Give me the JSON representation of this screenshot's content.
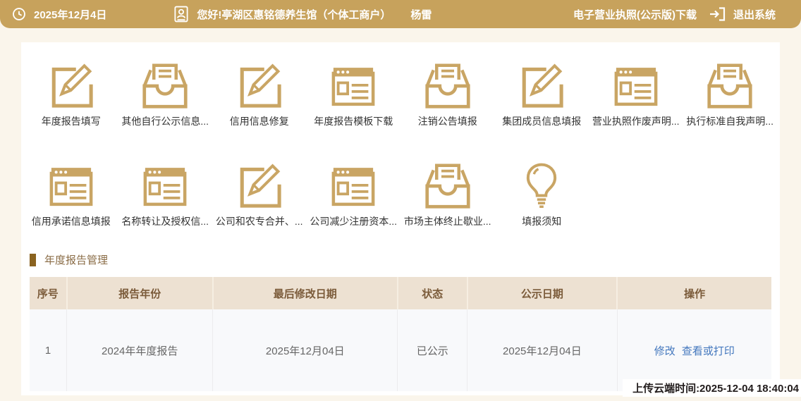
{
  "topbar": {
    "date": "2025年12月4日",
    "greeting": "您好!亭湖区惠铭德养生馆（个体工商户）",
    "username": "杨雷",
    "license_download": "电子营业执照(公示版)下载",
    "logout": "退出系统"
  },
  "menu": {
    "row1": [
      {
        "label": "年度报告填写",
        "icon": "edit-icon"
      },
      {
        "label": "其他自行公示信息...",
        "icon": "inbox-icon"
      },
      {
        "label": "信用信息修复",
        "icon": "edit-icon"
      },
      {
        "label": "年度报告模板下载",
        "icon": "browser-icon"
      },
      {
        "label": "注销公告填报",
        "icon": "inbox-icon"
      },
      {
        "label": "集团成员信息填报",
        "icon": "edit-icon"
      },
      {
        "label": "营业执照作废声明...",
        "icon": "browser-icon"
      },
      {
        "label": "执行标准自我声明...",
        "icon": "inbox-icon"
      }
    ],
    "row2": [
      {
        "label": "信用承诺信息填报",
        "icon": "browser-icon"
      },
      {
        "label": "名称转让及授权信...",
        "icon": "browser-icon"
      },
      {
        "label": "公司和农专合并、...",
        "icon": "edit-icon"
      },
      {
        "label": "公司减少注册资本...",
        "icon": "browser-icon"
      },
      {
        "label": "市场主体终止歇业...",
        "icon": "inbox-icon"
      },
      {
        "label": "填报须知",
        "icon": "bulb-icon"
      }
    ]
  },
  "section": {
    "title": "年度报告管理"
  },
  "table": {
    "headers": [
      "序号",
      "报告年份",
      "最后修改日期",
      "状态",
      "公示日期",
      "操作"
    ],
    "rows": [
      {
        "seq": "1",
        "year": "2024年年度报告",
        "modified": "2025年12月04日",
        "status": "已公示",
        "publish_date": "2025年12月04日",
        "actions": [
          "修改",
          "查看或打印"
        ]
      }
    ]
  },
  "footer": {
    "upload_time": "上传云端时间:2025-12-04 18:40:04"
  },
  "colors": {
    "topbar_gold": "#C7A25C",
    "icon_gold": "#C9A564",
    "header_bg": "#EDE1D2",
    "header_text": "#7B5B3A",
    "link_blue": "#4478BE",
    "section_title": "#8A6C46",
    "accent_bar": "#8A6320"
  }
}
